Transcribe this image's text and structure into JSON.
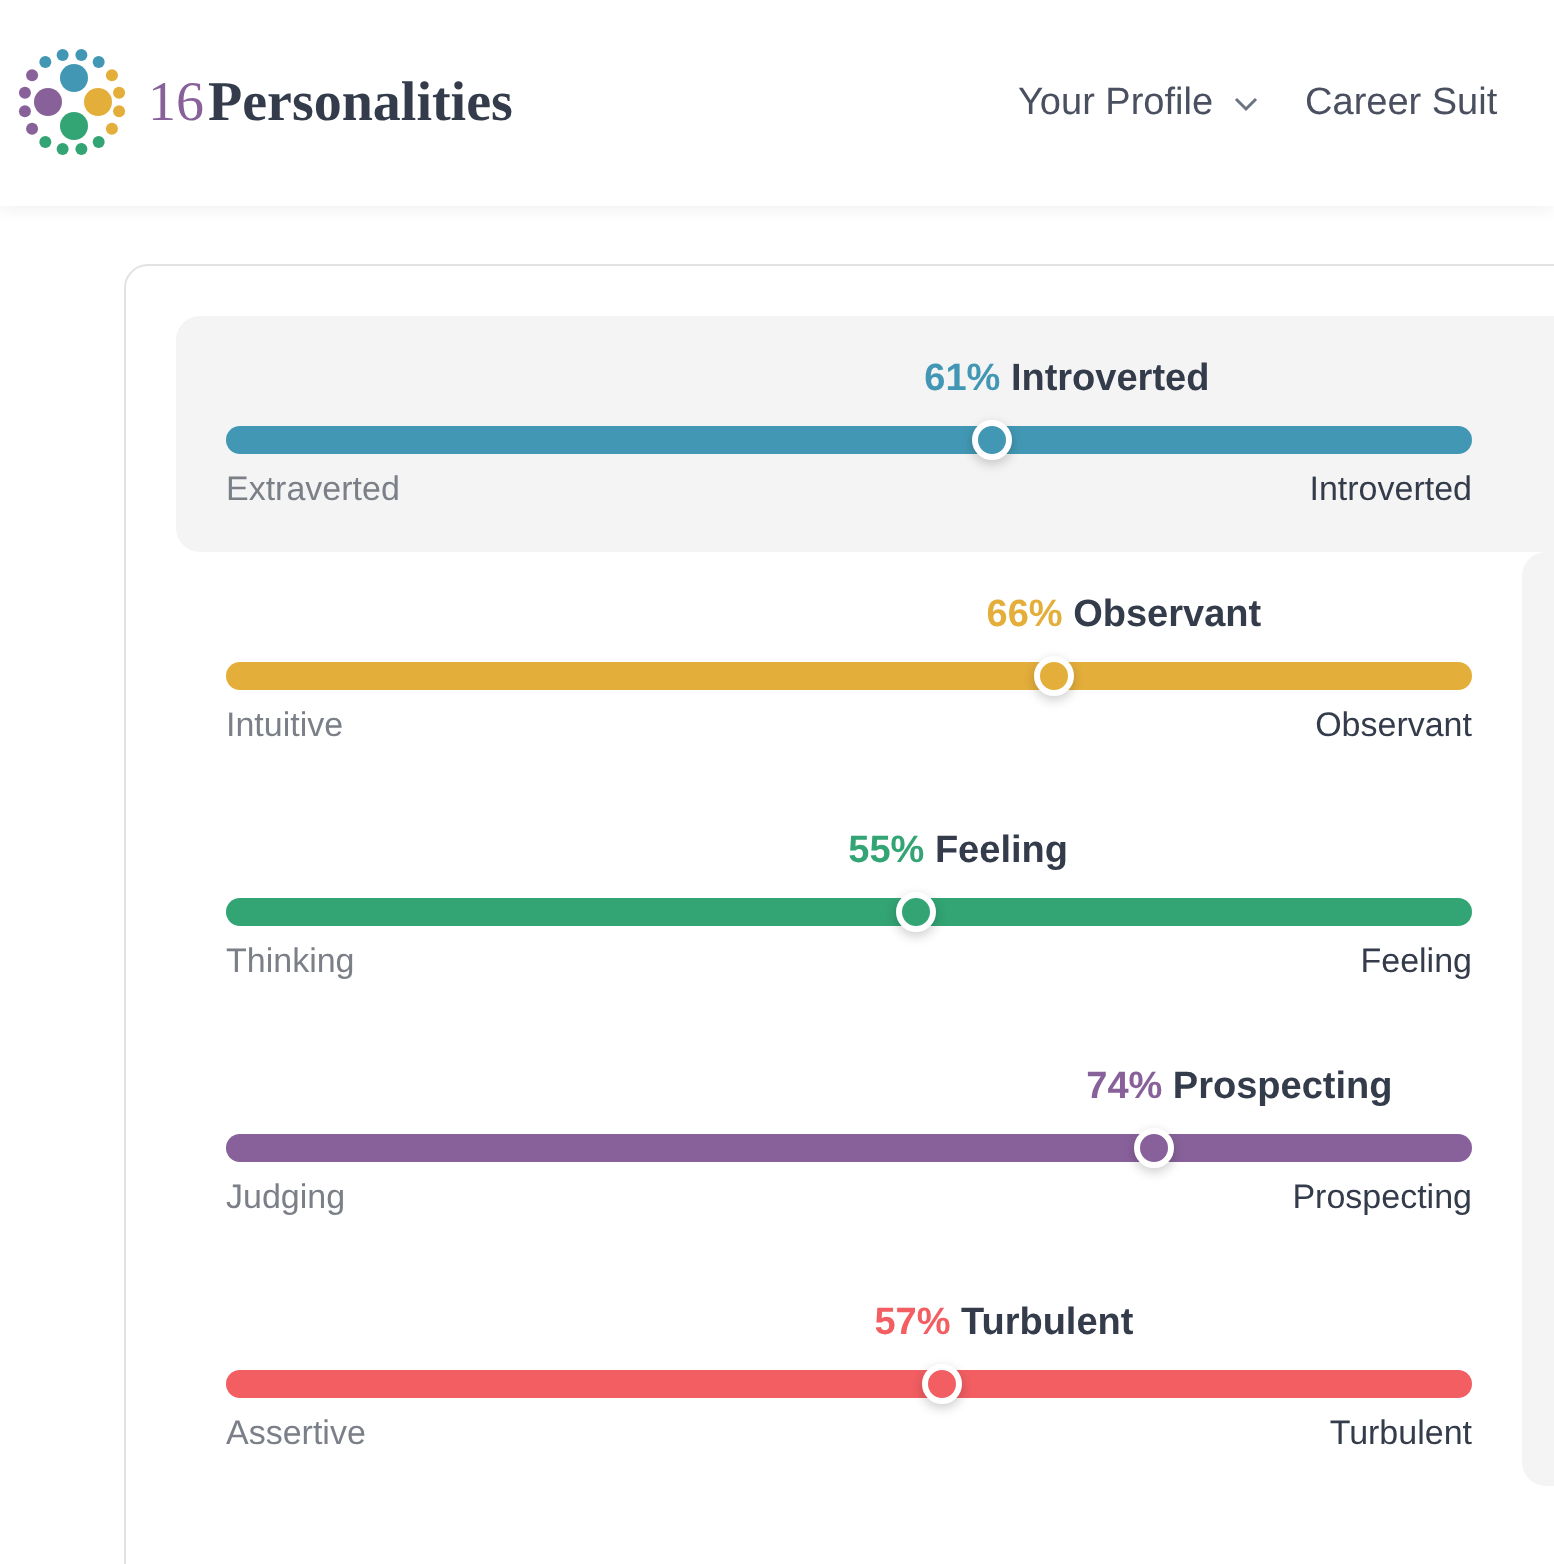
{
  "header": {
    "logo": {
      "number": "16",
      "name": "Personalities"
    },
    "nav": [
      {
        "label": "Your Profile",
        "has_menu": true
      },
      {
        "label": "Career Suit",
        "has_menu": false
      }
    ]
  },
  "traits": [
    {
      "percent": "61%",
      "trait": "Introverted",
      "left": "Extraverted",
      "right": "Introverted",
      "level": 0.615,
      "color": "#4298b4",
      "selected": true
    },
    {
      "percent": "66%",
      "trait": "Observant",
      "left": "Intuitive",
      "right": "Observant",
      "level": 0.665,
      "color": "#e4ae3a",
      "selected": false
    },
    {
      "percent": "55%",
      "trait": "Feeling",
      "left": "Thinking",
      "right": "Feeling",
      "level": 0.554,
      "color": "#33a474",
      "selected": false
    },
    {
      "percent": "74%",
      "trait": "Prospecting",
      "left": "Judging",
      "right": "Prospecting",
      "level": 0.745,
      "color": "#88619a",
      "selected": false
    },
    {
      "percent": "57%",
      "trait": "Turbulent",
      "left": "Assertive",
      "right": "Turbulent",
      "level": 0.575,
      "color": "#f25e62",
      "selected": false
    }
  ]
}
